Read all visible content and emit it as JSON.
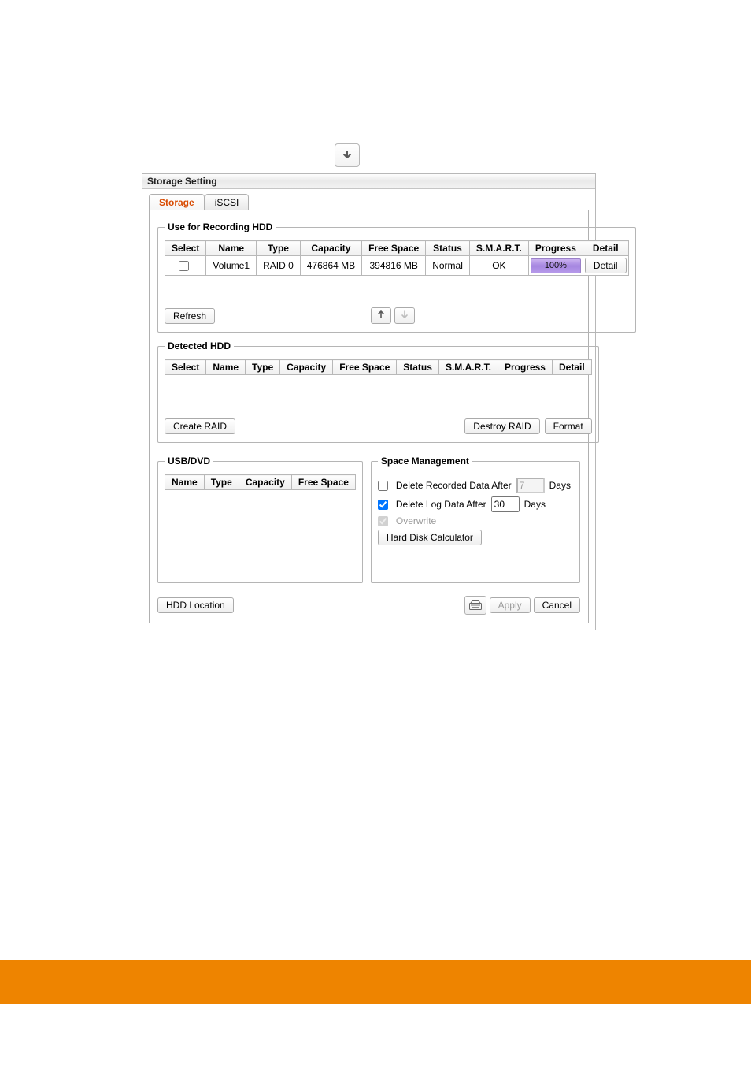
{
  "panel_title": "Storage Setting",
  "tabs": {
    "storage": "Storage",
    "iscsi": "iSCSI"
  },
  "recording_hdd": {
    "legend": "Use for Recording HDD",
    "columns": [
      "Select",
      "Name",
      "Type",
      "Capacity",
      "Free Space",
      "Status",
      "S.M.A.R.T.",
      "Progress",
      "Detail"
    ],
    "rows": [
      {
        "name": "Volume1",
        "type": "RAID 0",
        "capacity": "476864 MB",
        "free_space": "394816 MB",
        "status": "Normal",
        "smart": "OK",
        "progress": "100%",
        "detail_label": "Detail"
      }
    ],
    "refresh_label": "Refresh"
  },
  "detected_hdd": {
    "legend": "Detected HDD",
    "columns": [
      "Select",
      "Name",
      "Type",
      "Capacity",
      "Free Space",
      "Status",
      "S.M.A.R.T.",
      "Progress",
      "Detail"
    ],
    "create_raid_label": "Create RAID",
    "destroy_raid_label": "Destroy RAID",
    "format_label": "Format"
  },
  "usb_dvd": {
    "legend": "USB/DVD",
    "columns": [
      "Name",
      "Type",
      "Capacity",
      "Free Space"
    ]
  },
  "space_mgmt": {
    "legend": "Space Management",
    "delete_recorded_label": "Delete Recorded Data After",
    "delete_recorded_value": "7",
    "delete_log_label": "Delete Log Data After",
    "delete_log_value": "30",
    "days_label": "Days",
    "overwrite_label": "Overwrite",
    "calculator_label": "Hard Disk Calculator"
  },
  "footer": {
    "hdd_location_label": "HDD Location",
    "apply_label": "Apply",
    "cancel_label": "Cancel"
  }
}
